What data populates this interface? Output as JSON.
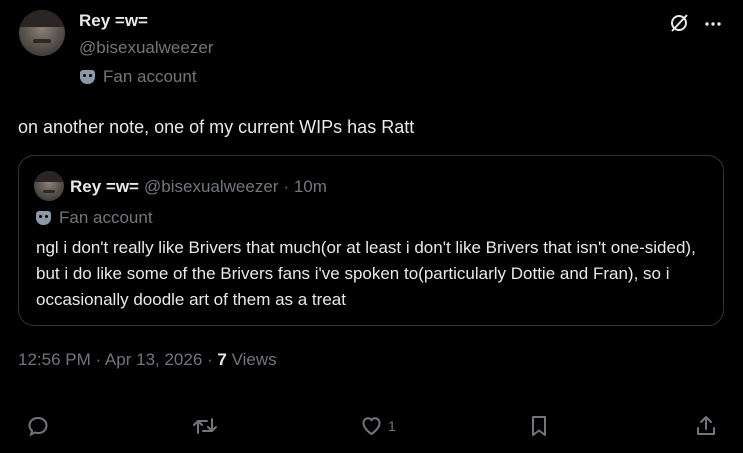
{
  "post": {
    "author_name": "Rey =w=",
    "author_handle": "@bisexualweezer",
    "badge_label": "Fan account",
    "text": "on another note, one of my current WIPs has Ratt",
    "timestamp": "12:56 PM · Apr 13, 2026 ·",
    "views_count": "7",
    "views_label": "Views"
  },
  "quoted": {
    "author_name": "Rey =w=",
    "author_handle": "@bisexualweezer",
    "time": "· 10m",
    "badge_label": "Fan account",
    "text": "ngl i don't really like Brivers that much(or at least i don't like Brivers that isn't one-sided), but i do like some of the Brivers fans i've spoken to(particularly Dottie and Fran), so i occasionally doodle art of them as a treat"
  },
  "actions": {
    "like_count": "1"
  },
  "icons": [
    "grok-icon",
    "more-icon",
    "reply-icon",
    "repost-icon",
    "like-icon",
    "bookmark-icon",
    "share-icon",
    "fan-account-icon"
  ]
}
